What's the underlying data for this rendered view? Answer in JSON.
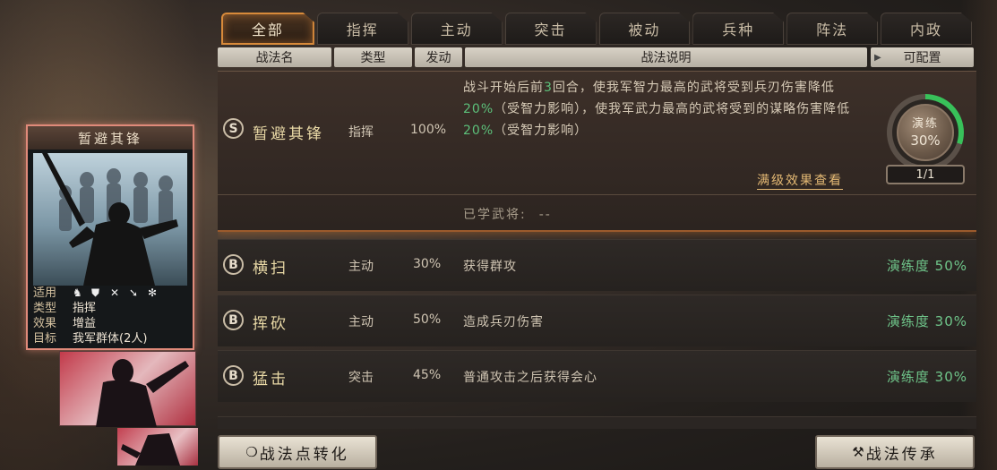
{
  "tabs": [
    "全部",
    "指挥",
    "主动",
    "突击",
    "被动",
    "兵种",
    "阵法",
    "内政"
  ],
  "header": {
    "name": "战法名",
    "type": "类型",
    "rate": "发动",
    "desc": "战法说明",
    "cfg": "可配置"
  },
  "selected": {
    "grade": "S",
    "name": "暂避其锋",
    "type": "指挥",
    "rate": "100%",
    "desc_parts": [
      "战斗开始后前",
      "3",
      "回合，使我军智力最高的武将受到兵刃伤害降低",
      "20%",
      "（受智力影响），使我军武力最高的武将受到的谋略伤害降低",
      "20%",
      "（受智力影响）"
    ],
    "more": "满级效果查看",
    "learned_label": "已学武将:",
    "learned_value": "--",
    "drill_label": "演练",
    "drill_pct": "30%",
    "drill_progress": 0.3,
    "count": "1/1"
  },
  "rows": [
    {
      "grade": "B",
      "name": "横扫",
      "type": "主动",
      "rate": "30%",
      "desc": "获得群攻",
      "prof": "演练度 50%"
    },
    {
      "grade": "B",
      "name": "挥砍",
      "type": "主动",
      "rate": "50%",
      "desc": "造成兵刃伤害",
      "prof": "演练度 30%"
    },
    {
      "grade": "B",
      "name": "猛击",
      "type": "突击",
      "rate": "45%",
      "desc": "普通攻击之后获得会心",
      "prof": "演练度 30%"
    }
  ],
  "card": {
    "title": "暂避其锋",
    "fit_label": "适用",
    "type_label": "类型",
    "type_value": "指挥",
    "effect_label": "效果",
    "effect_value": "增益",
    "target_label": "目标",
    "target_value": "我军群体(2人)",
    "fit_icons": [
      "cavalry-icon",
      "shield-icon",
      "bow-icon",
      "spear-icon",
      "chariot-icon"
    ]
  },
  "buttons": {
    "convert": "战法点转化",
    "inherit": "战法传承"
  }
}
